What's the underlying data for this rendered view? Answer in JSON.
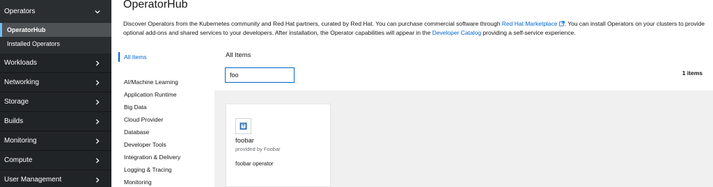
{
  "sidebar": {
    "groups": [
      {
        "label": "Operators",
        "expanded": true,
        "items": [
          "OperatorHub",
          "Installed Operators"
        ],
        "active_item": "OperatorHub"
      },
      {
        "label": "Workloads"
      },
      {
        "label": "Networking"
      },
      {
        "label": "Storage"
      },
      {
        "label": "Builds"
      },
      {
        "label": "Monitoring"
      },
      {
        "label": "Compute"
      },
      {
        "label": "User Management"
      }
    ]
  },
  "page": {
    "title": "OperatorHub",
    "intro": {
      "part1": "Discover Operators from the Kubernetes community and Red Hat partners, curated by Red Hat. You can purchase commercial software through ",
      "link1": "Red Hat Marketplace",
      "part2": ". You can install Operators on your clusters to provide optional add-ons and shared services to your developers. After installation, the Operator capabilities will appear in the ",
      "link2": "Developer Catalog",
      "part3": " providing a self-service experience."
    }
  },
  "categories": {
    "all_label": "All Items",
    "items": [
      "AI/Machine Learning",
      "Application Runtime",
      "Big Data",
      "Cloud Provider",
      "Database",
      "Developer Tools",
      "Integration & Delivery",
      "Logging & Tracing",
      "Monitoring"
    ]
  },
  "content": {
    "title": "All Items",
    "filter_value": "foo",
    "count": "1 items"
  },
  "tiles": [
    {
      "name": "foobar",
      "provider": "provided by Foobar",
      "description": "foobar operator",
      "logo_icon": "operator-placeholder-icon"
    }
  ],
  "colors": {
    "sidebar_bg": "#212427",
    "link": "#0066cc",
    "active_indicator": "#73bcf7"
  }
}
